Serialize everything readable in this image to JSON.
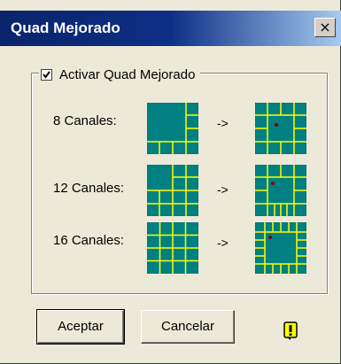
{
  "window": {
    "title": "Quad Mejorado",
    "close_label": "×"
  },
  "group": {
    "checkbox_label": "Activar Quad Mejorado",
    "checked": true
  },
  "rows": [
    {
      "label": "8 Canales:",
      "arrow": "->"
    },
    {
      "label": "12 Canales:",
      "arrow": "->"
    },
    {
      "label": "16 Canales:",
      "arrow": "->"
    }
  ],
  "buttons": {
    "ok": "Aceptar",
    "cancel": "Cancelar"
  },
  "colors": {
    "tile": "#008080",
    "grid_line": "#ffff00",
    "marker": "#800000",
    "titlebar": "#0a246a",
    "face": "#ece9d8"
  },
  "icons": {
    "close": "close-icon",
    "warning": "warning-icon",
    "check": "check-icon"
  }
}
